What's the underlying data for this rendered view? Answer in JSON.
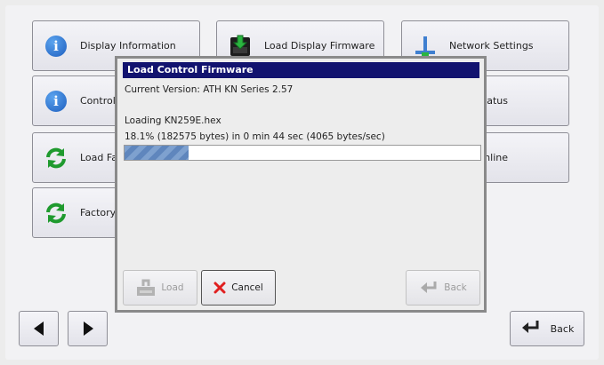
{
  "menu": {
    "display_information": "Display Information",
    "load_display_firmware": "Load Display Firmware",
    "network_settings": "Network Settings",
    "control_info": "Control In",
    "status": "Status",
    "load_factory": "Load Fac",
    "online": "Online",
    "factory_reset": "Factory R"
  },
  "dialog": {
    "title": "Load Control Firmware",
    "current_version": "Current Version: ATH KN Series 2.57",
    "loading_file": "Loading KN259E.hex",
    "progress_text": "18.1% (182575 bytes) in 0 min 44 sec (4065 bytes/sec)",
    "progress_fraction": 0.181,
    "load_label": "Load",
    "cancel_label": "Cancel",
    "back_label": "Back"
  },
  "footer": {
    "back_label": "Back"
  },
  "colors": {
    "title_bar": "#12136f",
    "progress_fill": "#6f93c6",
    "info_icon": "#1f5fbf",
    "refresh_icon": "#1f9a2e",
    "cancel_icon": "#e02020"
  }
}
